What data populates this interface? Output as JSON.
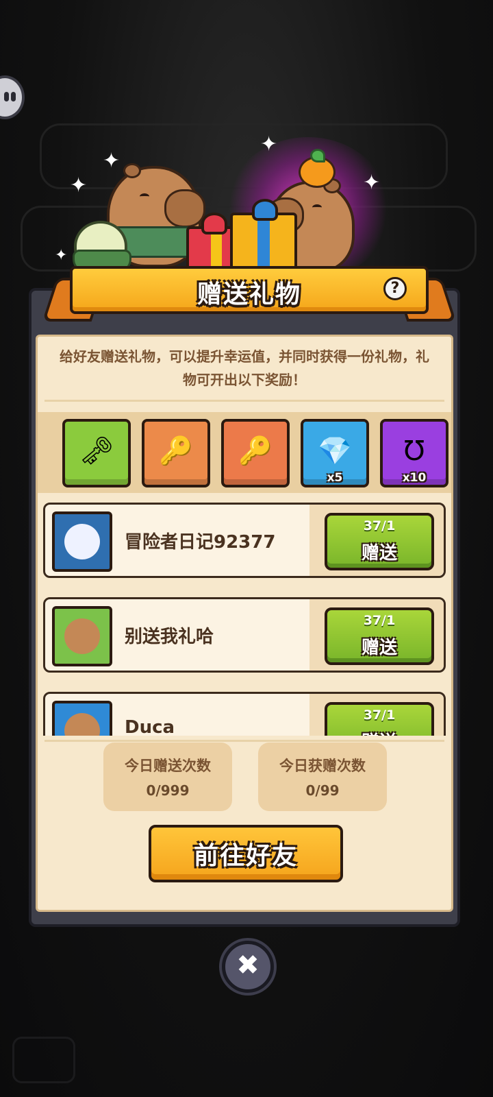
{
  "dialog": {
    "title": "赠送礼物",
    "help_icon": "question-icon",
    "description": "给好友赠送礼物，可以提升幸运值，并同时获得一份礼物，礼物可开出以下奖励！"
  },
  "rewards": [
    {
      "icon": "silver-key-icon",
      "glyph": "🗝",
      "color": "#8bcb3d",
      "quantity": ""
    },
    {
      "icon": "gold-key-icon",
      "glyph": "🔑",
      "color": "#ec8a4a",
      "quantity": ""
    },
    {
      "icon": "crystal-key-icon",
      "glyph": "🔑",
      "color": "#ec7a4a",
      "quantity": ""
    },
    {
      "icon": "crystal-gem-icon",
      "glyph": "💎",
      "color": "#3aa9e6",
      "quantity": "x5"
    },
    {
      "icon": "horseshoe-icon",
      "glyph": "Ʊ",
      "color": "#9a3fe0",
      "quantity": "x10"
    }
  ],
  "friends": [
    {
      "name": "冒险者日记92377",
      "count": "37/1",
      "button": "赠送",
      "avatar_icon": "princess-avatar-icon"
    },
    {
      "name": "别送我礼哈",
      "count": "37/1",
      "button": "赠送",
      "avatar_icon": "capybara-flower-avatar-icon"
    },
    {
      "name": "Duca",
      "count": "37/1",
      "button": "赠送",
      "avatar_icon": "capybara-avatar-icon"
    }
  ],
  "stats": {
    "sent_label": "今日赠送次数",
    "sent_value": "0/999",
    "received_label": "今日获赠次数",
    "received_value": "0/99"
  },
  "goto_button": "前往好友",
  "close_icon": "close-icon",
  "colors": {
    "banner": "#f8b426",
    "gift_button": "#8cc63a",
    "panel": "#f7e8cc",
    "frame": "#3e3f4a"
  }
}
